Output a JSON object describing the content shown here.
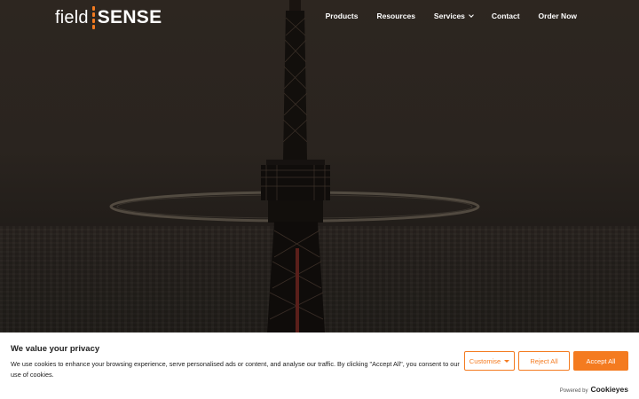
{
  "header": {
    "logo": {
      "left": "field",
      "right": "SENSE"
    },
    "nav": [
      {
        "label": "Products"
      },
      {
        "label": "Resources"
      },
      {
        "label": "Services"
      },
      {
        "label": "Contact"
      },
      {
        "label": "Order Now"
      }
    ]
  },
  "colors": {
    "accent": "#f47b20",
    "banner_bg": "#ffffff",
    "text": "#212121"
  },
  "cookie": {
    "title": "We value your privacy",
    "text": "We use cookies to enhance your browsing experience, serve personalised ads or content, and analyse our traffic. By clicking \"Accept All\", you consent to our use of cookies.",
    "customise_label": "Customise",
    "reject_label": "Reject All",
    "accept_label": "Accept All",
    "powered_by": "Powered by",
    "powered_brand": "Cookieyes"
  }
}
